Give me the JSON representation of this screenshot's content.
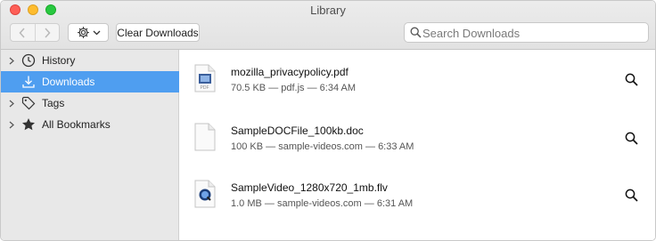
{
  "window": {
    "title": "Library"
  },
  "toolbar": {
    "clear_label": "Clear Downloads",
    "search_placeholder": "Search Downloads"
  },
  "sidebar": {
    "items": [
      {
        "label": "History",
        "icon": "clock-icon",
        "expandable": true,
        "selected": false
      },
      {
        "label": "Downloads",
        "icon": "download-icon",
        "expandable": false,
        "selected": true
      },
      {
        "label": "Tags",
        "icon": "tag-icon",
        "expandable": true,
        "selected": false
      },
      {
        "label": "All Bookmarks",
        "icon": "star-icon",
        "expandable": true,
        "selected": false
      }
    ]
  },
  "downloads": [
    {
      "name": "mozilla_privacypolicy.pdf",
      "meta": "70.5 KB — pdf.js — 6:34 AM",
      "icon": "pdf-file-icon"
    },
    {
      "name": "SampleDOCFile_100kb.doc",
      "meta": "100 KB — sample-videos.com — 6:33 AM",
      "icon": "doc-file-icon"
    },
    {
      "name": "SampleVideo_1280x720_1mb.flv",
      "meta": "1.0 MB — sample-videos.com — 6:31 AM",
      "icon": "video-file-icon"
    }
  ],
  "colors": {
    "selection": "#4f9ef0",
    "sidebar": "#e8e8e8"
  }
}
